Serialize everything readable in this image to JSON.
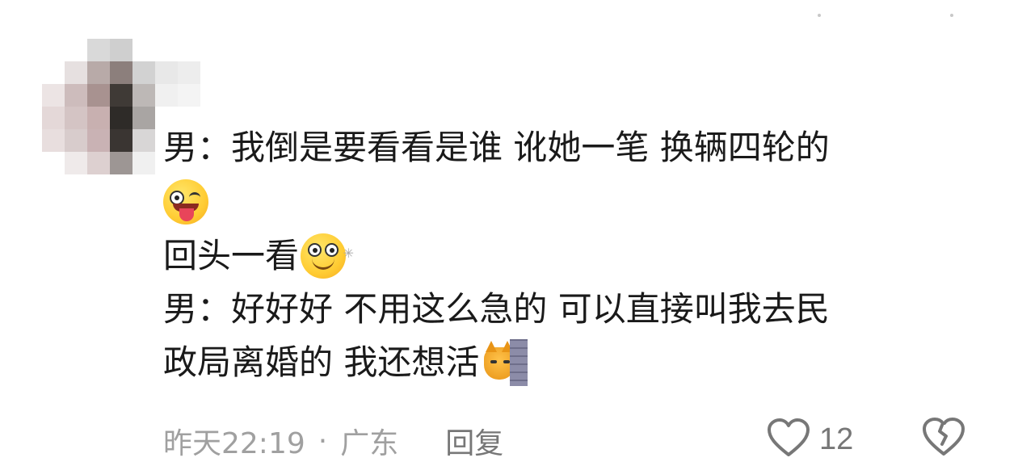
{
  "comment": {
    "line1": "男：我倒是要看看是谁 讹她一笔 换辆四轮的",
    "line3": "回头一看",
    "line4": "男：好好好 不用这么急的 可以直接叫我去民",
    "line5": "政局离婚的 我还想活"
  },
  "emojis": {
    "line2": "tongue-wink-emoji",
    "line3": "dizzy-eyes-emoji",
    "line5": "cat-peeking-wall-emoji"
  },
  "meta": {
    "time": "昨天22:19",
    "separator": "·",
    "location": "广东",
    "reply_label": "回复"
  },
  "actions": {
    "like_count": "12",
    "like_icon": "heart-outline-icon",
    "dislike_icon": "broken-heart-icon"
  },
  "colors": {
    "text": "#1a1a1a",
    "meta": "#a0a0a0",
    "icon": "#777777"
  }
}
